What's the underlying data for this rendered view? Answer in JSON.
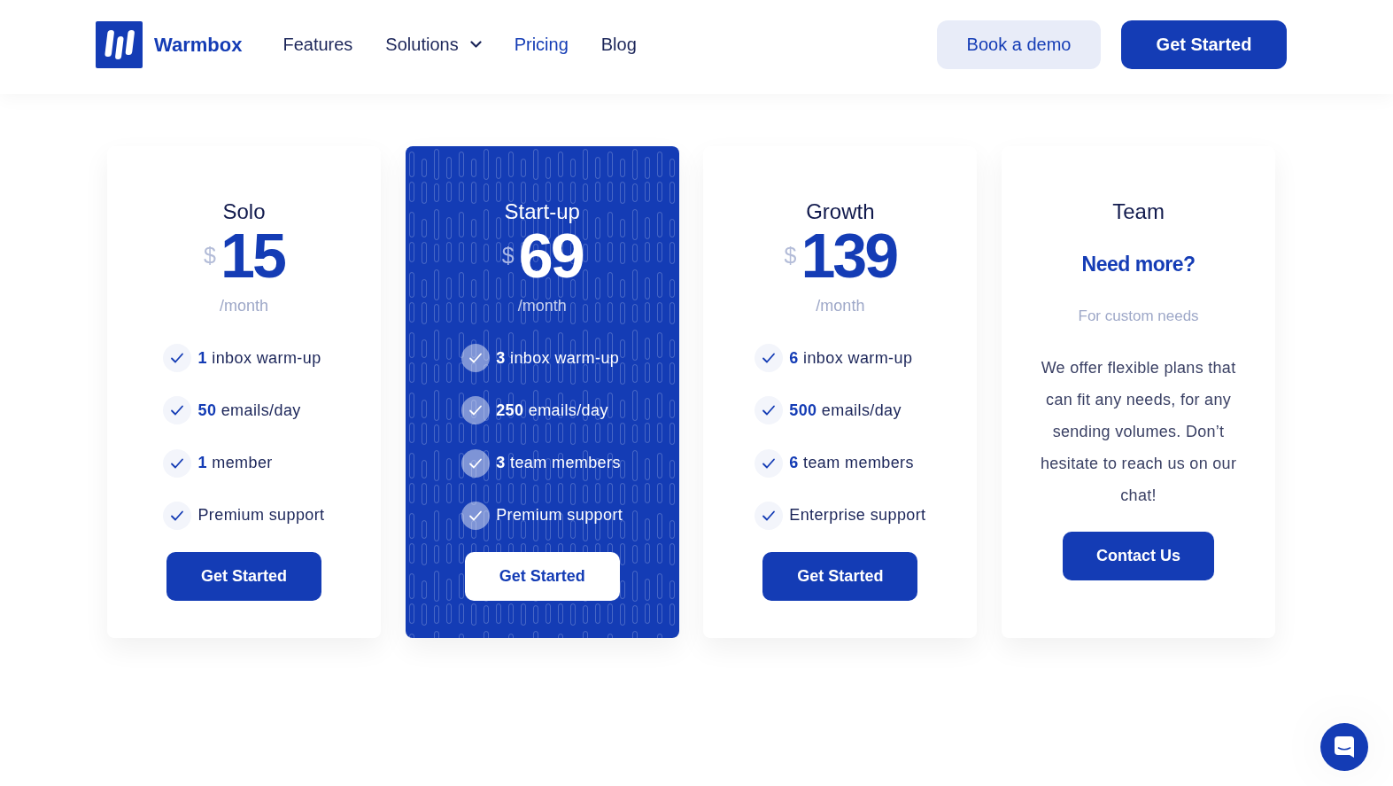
{
  "header": {
    "brand": "Warmbox",
    "nav": [
      {
        "label": "Features",
        "selected": false,
        "dropdown": false
      },
      {
        "label": "Solutions",
        "selected": false,
        "dropdown": true
      },
      {
        "label": "Pricing",
        "selected": true,
        "dropdown": false
      },
      {
        "label": "Blog",
        "selected": false,
        "dropdown": false
      }
    ],
    "actions": [
      {
        "label": "Book a demo",
        "kind": "secondary"
      },
      {
        "label": "Get Started",
        "kind": "primary"
      }
    ]
  },
  "plans": [
    {
      "kind": "priced",
      "title": "Solo",
      "highlighted": false,
      "currency": "$",
      "price": "15",
      "period": "/month",
      "features": [
        "**1** inbox warm-up",
        "**50** emails/day",
        "**1** member",
        "Premium support"
      ],
      "button": "Get Started"
    },
    {
      "kind": "priced",
      "title": "Start-up",
      "highlighted": true,
      "currency": "$",
      "price": "69",
      "period": "/month",
      "features": [
        "**3** inbox warm-up",
        "**250** emails/day",
        "**3** team members",
        "Premium support"
      ],
      "button": "Get Started"
    },
    {
      "kind": "priced",
      "title": "Growth",
      "highlighted": false,
      "currency": "$",
      "price": "139",
      "period": "/month",
      "features": [
        "**6** inbox warm-up",
        "**500** emails/day",
        "**6** team members",
        "Enterprise support"
      ],
      "button": "Get Started"
    },
    {
      "kind": "custom",
      "title": "Team",
      "highlighted": false,
      "headline": "Need more?",
      "subtitle": "For custom needs",
      "description": "We offer flexible plans that can fit any needs, for any sending volumes. Don’t hesitate to reach us on our chat!",
      "button": "Contact Us"
    }
  ]
}
